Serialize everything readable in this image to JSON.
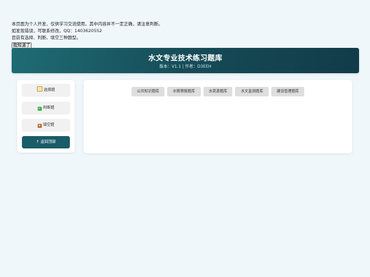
{
  "notice": {
    "line1": "本页面为个人开发，仅供学习交流使用，其中内容并不一定正确，请注意判断。",
    "line2": "如发现错误，可联系修改，QQ：1403620552",
    "line3": "目前有选择、判断、填空三种题型。",
    "ack_label": "我知道了"
  },
  "header": {
    "title": "水文专业技术练习题库",
    "subtitle": "版本：V1.1 | 作者：D3EEH"
  },
  "sidebar": {
    "items": [
      {
        "label": "选择题",
        "icon": "memo-icon"
      },
      {
        "label": "判断题",
        "icon": "check-mark-icon"
      },
      {
        "label": "填空题",
        "icon": "inbox-icon"
      },
      {
        "label": "↑ 返回顶部",
        "icon": ""
      }
    ]
  },
  "main": {
    "tabs": [
      {
        "label": "公共知识题库"
      },
      {
        "label": "水情预报题库"
      },
      {
        "label": "水资源题库"
      },
      {
        "label": "水文监测题库"
      },
      {
        "label": "建设管理题库"
      }
    ]
  },
  "colors": {
    "header_start": "#1f6c74",
    "header_end": "#123b48",
    "accent": "#1a5c68",
    "page_bg": "#f0f7fb"
  }
}
